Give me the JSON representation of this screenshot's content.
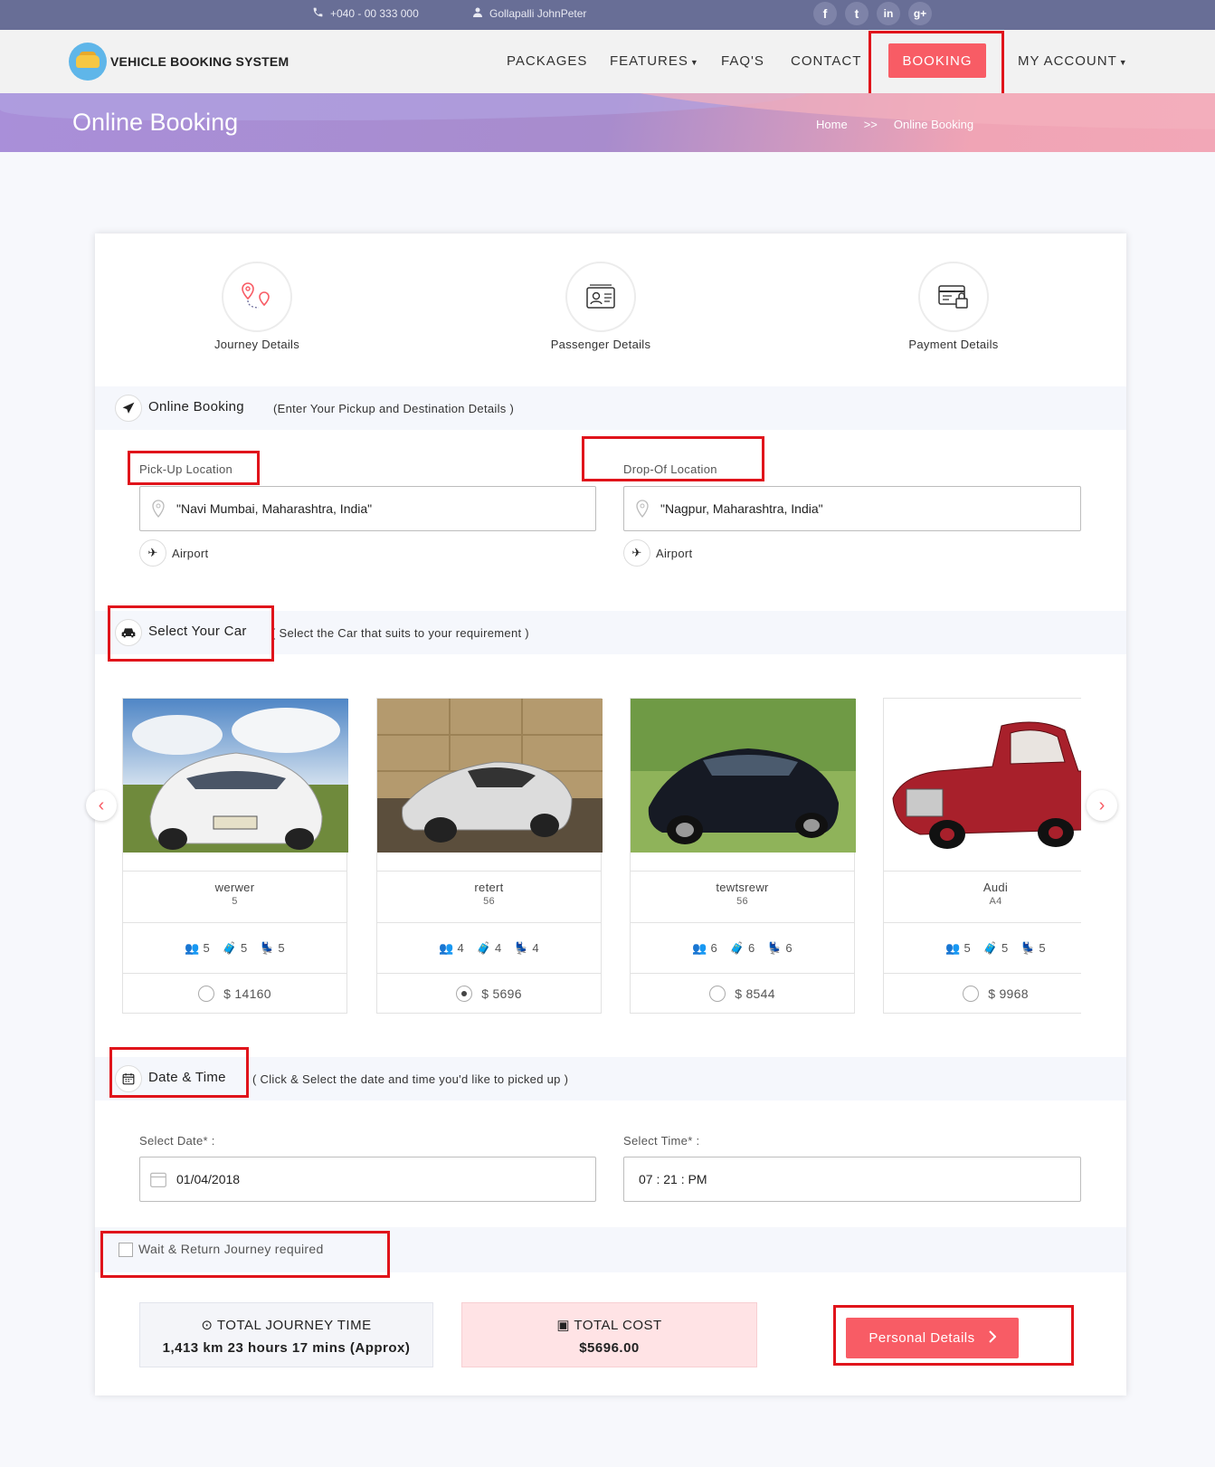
{
  "topbar": {
    "phone": "+040 - 00 333 000",
    "user": "Gollapalli JohnPeter",
    "socials": [
      {
        "icon": "facebook-icon",
        "glyph": "f"
      },
      {
        "icon": "twitter-icon",
        "glyph": "t"
      },
      {
        "icon": "linkedin-icon",
        "glyph": "in"
      },
      {
        "icon": "google-plus-icon",
        "glyph": "g+"
      }
    ]
  },
  "nav": {
    "brand": "VEHICLE BOOKING SYSTEM",
    "packages": "PACKAGES",
    "features": "FEATURES",
    "faqs": "FAQ'S",
    "contact": "CONTACT",
    "booking": "BOOKING",
    "account": "MY ACCOUNT"
  },
  "banner": {
    "title": "Online Booking",
    "crumb_home": "Home",
    "crumb_sep": ">>",
    "crumb_current": "Online Booking"
  },
  "steps": {
    "journey": "Journey Details",
    "passenger": "Passenger Details",
    "payment": "Payment Details"
  },
  "booking_section": {
    "title": "Online Booking",
    "subtitle": "(Enter Your Pickup and Destination Details )",
    "pickup_label": "Pick-Up Location",
    "pickup_value": "\"Navi Mumbai, Maharashtra, India\"",
    "dropoff_label": "Drop-Of Location",
    "dropoff_value": "\"Nagpur, Maharashtra, India\"",
    "airport": "Airport"
  },
  "car_section": {
    "title": "Select Your Car",
    "subtitle": "( Select the Car that suits to your requirement )",
    "cars": [
      {
        "name": "werwer",
        "sub": "5",
        "passengers": "5",
        "luggage": "5",
        "seats": "5",
        "price": "$ 14160",
        "selected": false
      },
      {
        "name": "retert",
        "sub": "56",
        "passengers": "4",
        "luggage": "4",
        "seats": "4",
        "price": "$ 5696",
        "selected": true
      },
      {
        "name": "tewtsrewr",
        "sub": "56",
        "passengers": "6",
        "luggage": "6",
        "seats": "6",
        "price": "$ 8544",
        "selected": false
      },
      {
        "name": "Audi",
        "sub": "A4",
        "passengers": "5",
        "luggage": "5",
        "seats": "5",
        "price": "$ 9968",
        "selected": false
      }
    ]
  },
  "date_section": {
    "title": "Date & Time",
    "subtitle": "( Click & Select the date and time you'd like to picked up )",
    "date_label": "Select Date* :",
    "date_value": "01/04/2018",
    "time_label": "Select Time* :",
    "time_value": "07 : 21 : PM"
  },
  "wait_return": "Wait & Return Journey required",
  "summary": {
    "time_title": "TOTAL JOURNEY TIME",
    "time_value": "1,413 km 23 hours 17 mins (Approx)",
    "cost_title": "TOTAL COST",
    "cost_value": "$5696.00"
  },
  "next_button": "Personal Details",
  "colors": {
    "accent": "#f85c65",
    "topbar": "#686e96",
    "annotation": "#e0141b"
  }
}
